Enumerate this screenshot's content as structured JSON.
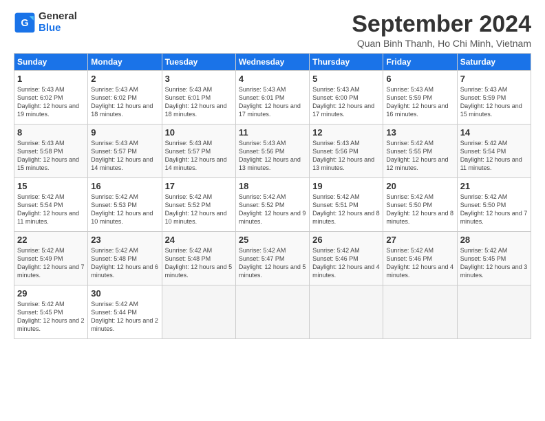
{
  "header": {
    "logo_line1": "General",
    "logo_line2": "Blue",
    "month_year": "September 2024",
    "location": "Quan Binh Thanh, Ho Chi Minh, Vietnam"
  },
  "columns": [
    "Sunday",
    "Monday",
    "Tuesday",
    "Wednesday",
    "Thursday",
    "Friday",
    "Saturday"
  ],
  "weeks": [
    [
      {
        "day": "1",
        "sunrise": "5:43 AM",
        "sunset": "6:02 PM",
        "daylight": "12 hours and 19 minutes."
      },
      {
        "day": "2",
        "sunrise": "5:43 AM",
        "sunset": "6:02 PM",
        "daylight": "12 hours and 18 minutes."
      },
      {
        "day": "3",
        "sunrise": "5:43 AM",
        "sunset": "6:01 PM",
        "daylight": "12 hours and 18 minutes."
      },
      {
        "day": "4",
        "sunrise": "5:43 AM",
        "sunset": "6:01 PM",
        "daylight": "12 hours and 17 minutes."
      },
      {
        "day": "5",
        "sunrise": "5:43 AM",
        "sunset": "6:00 PM",
        "daylight": "12 hours and 17 minutes."
      },
      {
        "day": "6",
        "sunrise": "5:43 AM",
        "sunset": "5:59 PM",
        "daylight": "12 hours and 16 minutes."
      },
      {
        "day": "7",
        "sunrise": "5:43 AM",
        "sunset": "5:59 PM",
        "daylight": "12 hours and 15 minutes."
      }
    ],
    [
      {
        "day": "8",
        "sunrise": "5:43 AM",
        "sunset": "5:58 PM",
        "daylight": "12 hours and 15 minutes."
      },
      {
        "day": "9",
        "sunrise": "5:43 AM",
        "sunset": "5:57 PM",
        "daylight": "12 hours and 14 minutes."
      },
      {
        "day": "10",
        "sunrise": "5:43 AM",
        "sunset": "5:57 PM",
        "daylight": "12 hours and 14 minutes."
      },
      {
        "day": "11",
        "sunrise": "5:43 AM",
        "sunset": "5:56 PM",
        "daylight": "12 hours and 13 minutes."
      },
      {
        "day": "12",
        "sunrise": "5:43 AM",
        "sunset": "5:56 PM",
        "daylight": "12 hours and 13 minutes."
      },
      {
        "day": "13",
        "sunrise": "5:42 AM",
        "sunset": "5:55 PM",
        "daylight": "12 hours and 12 minutes."
      },
      {
        "day": "14",
        "sunrise": "5:42 AM",
        "sunset": "5:54 PM",
        "daylight": "12 hours and 11 minutes."
      }
    ],
    [
      {
        "day": "15",
        "sunrise": "5:42 AM",
        "sunset": "5:54 PM",
        "daylight": "12 hours and 11 minutes."
      },
      {
        "day": "16",
        "sunrise": "5:42 AM",
        "sunset": "5:53 PM",
        "daylight": "12 hours and 10 minutes."
      },
      {
        "day": "17",
        "sunrise": "5:42 AM",
        "sunset": "5:52 PM",
        "daylight": "12 hours and 10 minutes."
      },
      {
        "day": "18",
        "sunrise": "5:42 AM",
        "sunset": "5:52 PM",
        "daylight": "12 hours and 9 minutes."
      },
      {
        "day": "19",
        "sunrise": "5:42 AM",
        "sunset": "5:51 PM",
        "daylight": "12 hours and 8 minutes."
      },
      {
        "day": "20",
        "sunrise": "5:42 AM",
        "sunset": "5:50 PM",
        "daylight": "12 hours and 8 minutes."
      },
      {
        "day": "21",
        "sunrise": "5:42 AM",
        "sunset": "5:50 PM",
        "daylight": "12 hours and 7 minutes."
      }
    ],
    [
      {
        "day": "22",
        "sunrise": "5:42 AM",
        "sunset": "5:49 PM",
        "daylight": "12 hours and 7 minutes."
      },
      {
        "day": "23",
        "sunrise": "5:42 AM",
        "sunset": "5:48 PM",
        "daylight": "12 hours and 6 minutes."
      },
      {
        "day": "24",
        "sunrise": "5:42 AM",
        "sunset": "5:48 PM",
        "daylight": "12 hours and 5 minutes."
      },
      {
        "day": "25",
        "sunrise": "5:42 AM",
        "sunset": "5:47 PM",
        "daylight": "12 hours and 5 minutes."
      },
      {
        "day": "26",
        "sunrise": "5:42 AM",
        "sunset": "5:46 PM",
        "daylight": "12 hours and 4 minutes."
      },
      {
        "day": "27",
        "sunrise": "5:42 AM",
        "sunset": "5:46 PM",
        "daylight": "12 hours and 4 minutes."
      },
      {
        "day": "28",
        "sunrise": "5:42 AM",
        "sunset": "5:45 PM",
        "daylight": "12 hours and 3 minutes."
      }
    ],
    [
      {
        "day": "29",
        "sunrise": "5:42 AM",
        "sunset": "5:45 PM",
        "daylight": "12 hours and 2 minutes."
      },
      {
        "day": "30",
        "sunrise": "5:42 AM",
        "sunset": "5:44 PM",
        "daylight": "12 hours and 2 minutes."
      },
      null,
      null,
      null,
      null,
      null
    ]
  ]
}
